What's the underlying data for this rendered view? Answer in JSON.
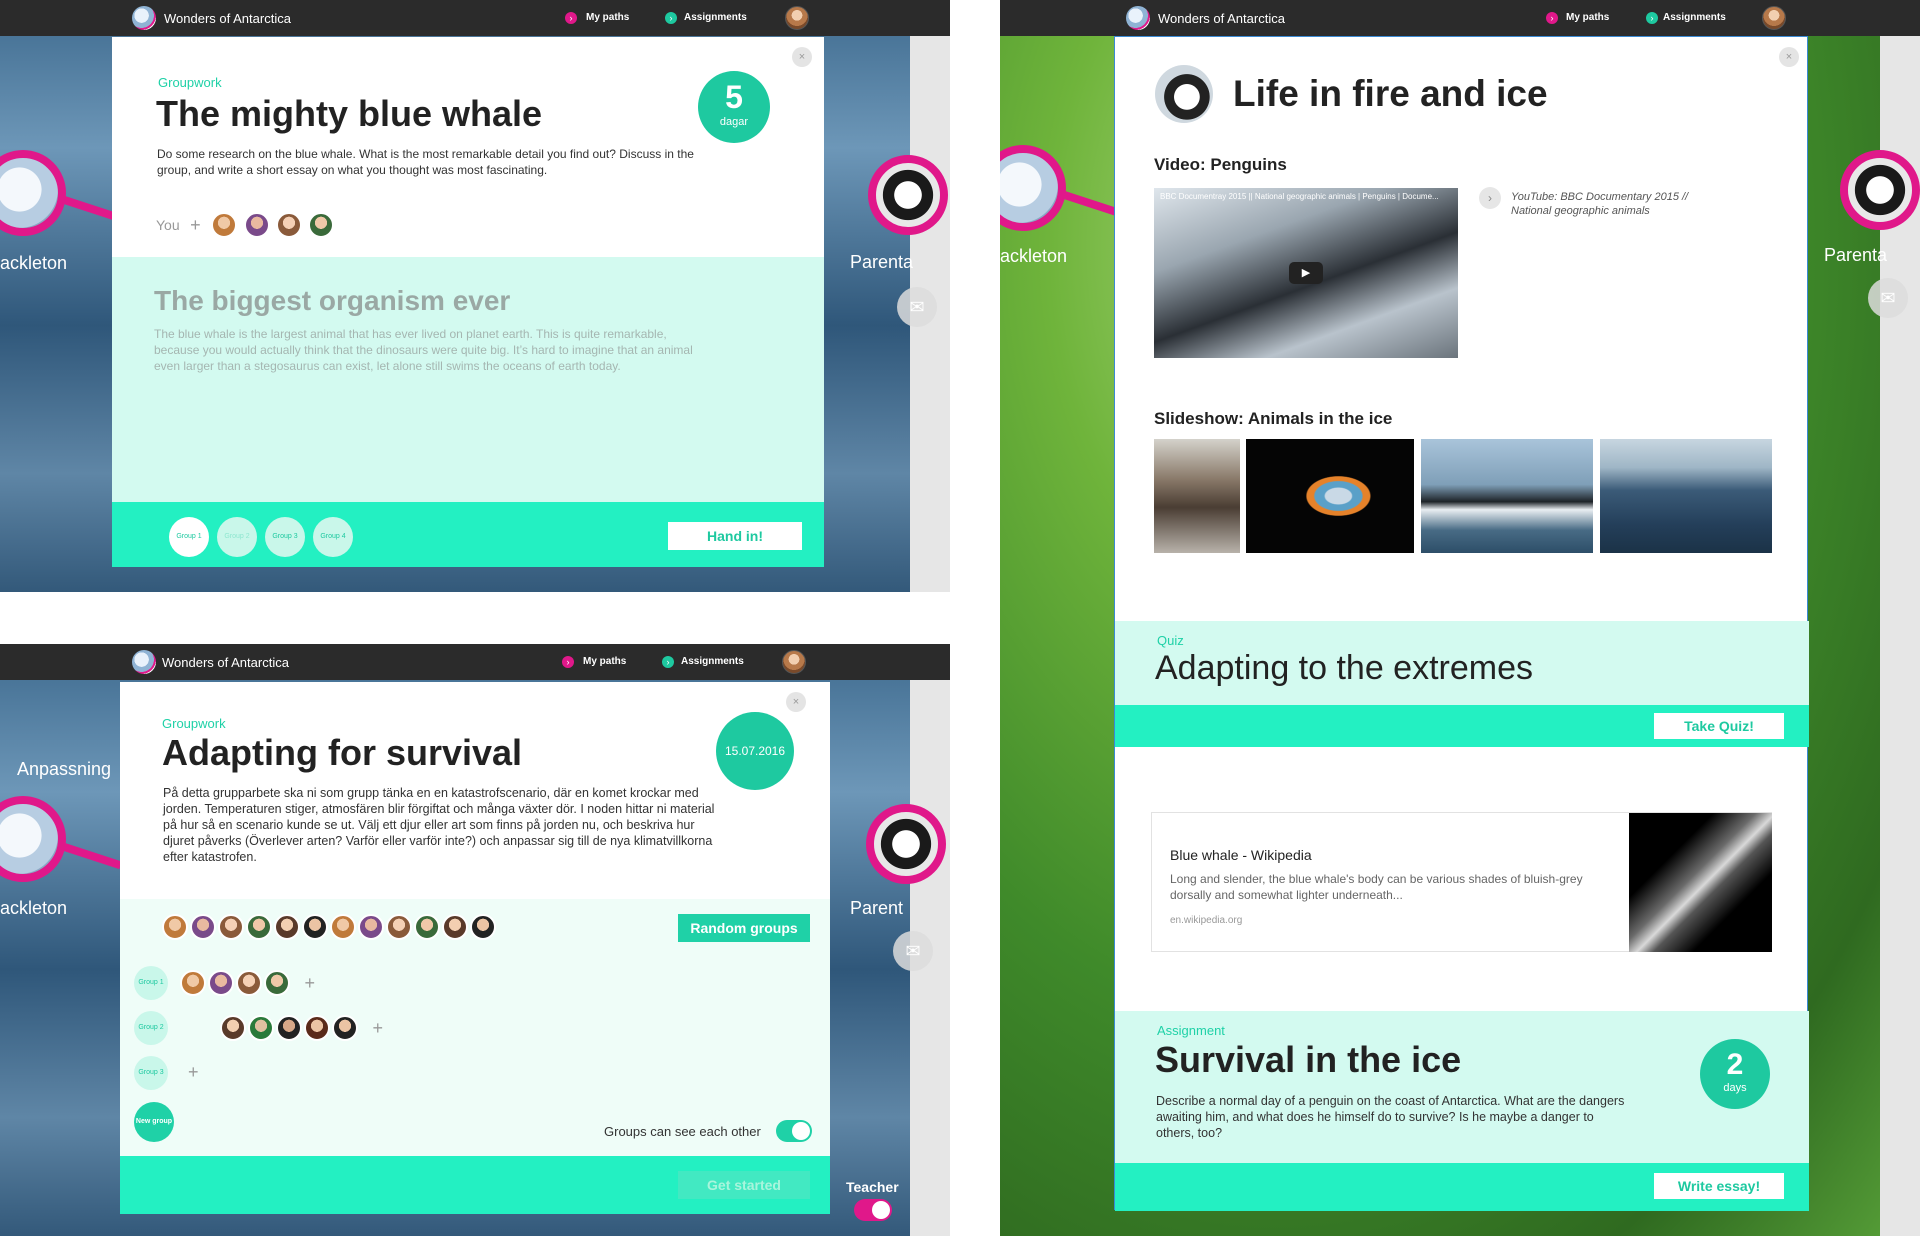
{
  "app": {
    "title": "Wonders of Antarctica",
    "nav_my_paths": "My paths",
    "nav_assignments": "Assignments"
  },
  "colors": {
    "accent": "#1ec9a0",
    "mint": "#d3faf0",
    "bar": "#23f0c2",
    "pink": "#e0188a",
    "topbar": "#2b2b2b"
  },
  "panel1": {
    "side_left": "ackleton",
    "side_right": "Parenta",
    "eyebrow": "Groupwork",
    "title": "The mighty blue whale",
    "body": "Do some research on the blue whale. What is the most remarkable detail you find out? Discuss in the group, and write a short essay on what you thought was most fascinating.",
    "badge_value": "5",
    "badge_unit": "dagar",
    "you_label": "You",
    "plus": "+",
    "section_title": "The biggest organism ever",
    "section_body": "The blue whale is the largest animal that has ever lived on planet earth. This is quite remarkable, because you would actually think that the dinosaurs were quite big. It’s hard to imagine that an animal even larger than a stegosaurus can exist, let alone still swims the oceans of earth today.",
    "groups": [
      "Group 1",
      "Group 2",
      "Group 3",
      "Group 4"
    ],
    "hand_in": "Hand in!",
    "close": "×"
  },
  "panel2": {
    "side_left_top": "Anpassning",
    "side_left": "ackleton",
    "side_right": "Parent",
    "eyebrow": "Groupwork",
    "title": "Adapting for survival",
    "date": "15.07.2016",
    "body": "På detta grupparbete ska ni som grupp tänka en en katastrofscenario, där en komet krockar med jorden. Temperaturen stiger, atmosfären blir förgiftat och många växter dör. I noden hittar ni material på hur så en scenario kunde se ut. Välj ett djur eller art som finns på jorden nu, och beskriva hur djuret påverks (Överlever arten? Varför eller varför inte?) och anpassar sig till de nya klimatvillkorna efter katastrofen.",
    "random_groups": "Random groups",
    "groups": [
      "Group 1",
      "Group 2",
      "Group 3"
    ],
    "new_group": "New group",
    "plus": "+",
    "toggle_label": "Groups can see each other",
    "get_started": "Get started",
    "teacher": "Teacher",
    "close": "×"
  },
  "panel3": {
    "side_left": "ackleton",
    "side_right": "Parenta",
    "title": "Life in fire and ice",
    "video_heading": "Video: Penguins",
    "video_caption": "BBC Documentray 2015 || National geographic animals | Penguins | Docume...",
    "video_source": "YouTube: BBC Documentary 2015 // National geographic animals",
    "slideshow_heading": "Slideshow: Animals in the ice",
    "quiz_eyebrow": "Quiz",
    "quiz_title": "Adapting to the extremes",
    "take_quiz": "Take Quiz!",
    "wiki_title": "Blue whale - Wikipedia",
    "wiki_body": "Long and slender, the blue whale's body can be various shades of bluish-grey dorsally and somewhat lighter underneath...",
    "wiki_url": "en.wikipedia.org",
    "assign_eyebrow": "Assignment",
    "assign_title": "Survival in the ice",
    "assign_body": "Describe a normal day of a penguin on the coast of Antarctica. What are the dangers awaiting him, and what does he himself do to survive? Is he maybe a danger to others, too?",
    "badge_value": "2",
    "badge_unit": "days",
    "write_essay": "Write essay!",
    "close": "×"
  }
}
